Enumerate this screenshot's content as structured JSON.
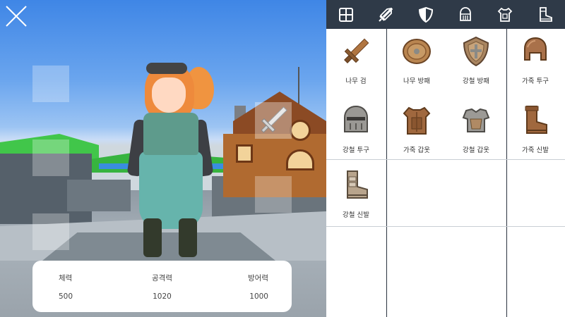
{
  "stats": [
    {
      "label": "체력",
      "value": "500"
    },
    {
      "label": "공격력",
      "value": "1020"
    },
    {
      "label": "방어력",
      "value": "1000"
    }
  ],
  "tabs": [
    {
      "icon": "grid-icon"
    },
    {
      "icon": "sword-icon"
    },
    {
      "icon": "shield-icon"
    },
    {
      "icon": "helmet-icon"
    },
    {
      "icon": "armor-icon"
    },
    {
      "icon": "boots-icon"
    }
  ],
  "items": [
    {
      "name": "나무 검",
      "icon": "wooden-sword-icon"
    },
    {
      "name": "나무 방패",
      "icon": "wooden-shield-icon"
    },
    {
      "name": "강철 방패",
      "icon": "steel-shield-icon"
    },
    {
      "name": "가죽 투구",
      "icon": "leather-helmet-icon"
    },
    {
      "name": "강철 투구",
      "icon": "steel-helmet-icon"
    },
    {
      "name": "가죽 갑옷",
      "icon": "leather-armor-icon"
    },
    {
      "name": "강철 갑옷",
      "icon": "steel-armor-icon"
    },
    {
      "name": "가죽 신발",
      "icon": "leather-boots-icon"
    },
    {
      "name": "강철 신발",
      "icon": "steel-boots-icon"
    }
  ],
  "colors": {
    "tabbar": "#2f3a48",
    "wood": "#a0643a",
    "steel": "#8c8a86",
    "leather": "#9a6a40"
  }
}
